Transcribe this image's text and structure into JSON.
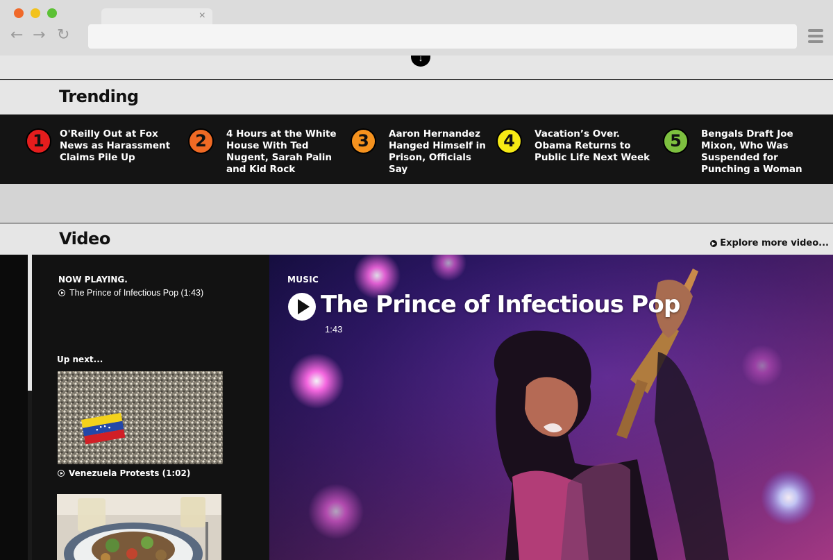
{
  "browser": {
    "tab_close": "×",
    "back": "←",
    "forward": "→",
    "reload": "↻"
  },
  "trending": {
    "title": "Trending",
    "items": [
      {
        "num": "1",
        "color": "#e51d1d",
        "text": "O'Reilly Out at Fox News as Harassment Claims Pile Up"
      },
      {
        "num": "2",
        "color": "#f06a24",
        "text": "4 Hours at the White House With Ted Nugent, Sarah Palin and Kid Rock"
      },
      {
        "num": "3",
        "color": "#f5921e",
        "text": "Aaron Hernandez Hanged Himself in Prison, Officials Say"
      },
      {
        "num": "4",
        "color": "#f6ea15",
        "text": "Vacation’s Over. Obama Returns to Public Life Next Week"
      },
      {
        "num": "5",
        "color": "#7dc03f",
        "text": "Bengals Draft Joe Mixon, Who Was Suspended for Punching a Woman"
      }
    ]
  },
  "video": {
    "title": "Video",
    "explore_link": "Explore more video...",
    "now_playing_label": "NOW PLAYING.",
    "now_playing_title": "The Prince of Infectious Pop (1:43)",
    "up_next_label": "Up next...",
    "up_next": [
      {
        "caption": "Venezuela Protests (1:02)"
      }
    ],
    "player": {
      "category": "MUSIC",
      "title": "The Prince of Infectious Pop",
      "duration": "1:43"
    }
  }
}
